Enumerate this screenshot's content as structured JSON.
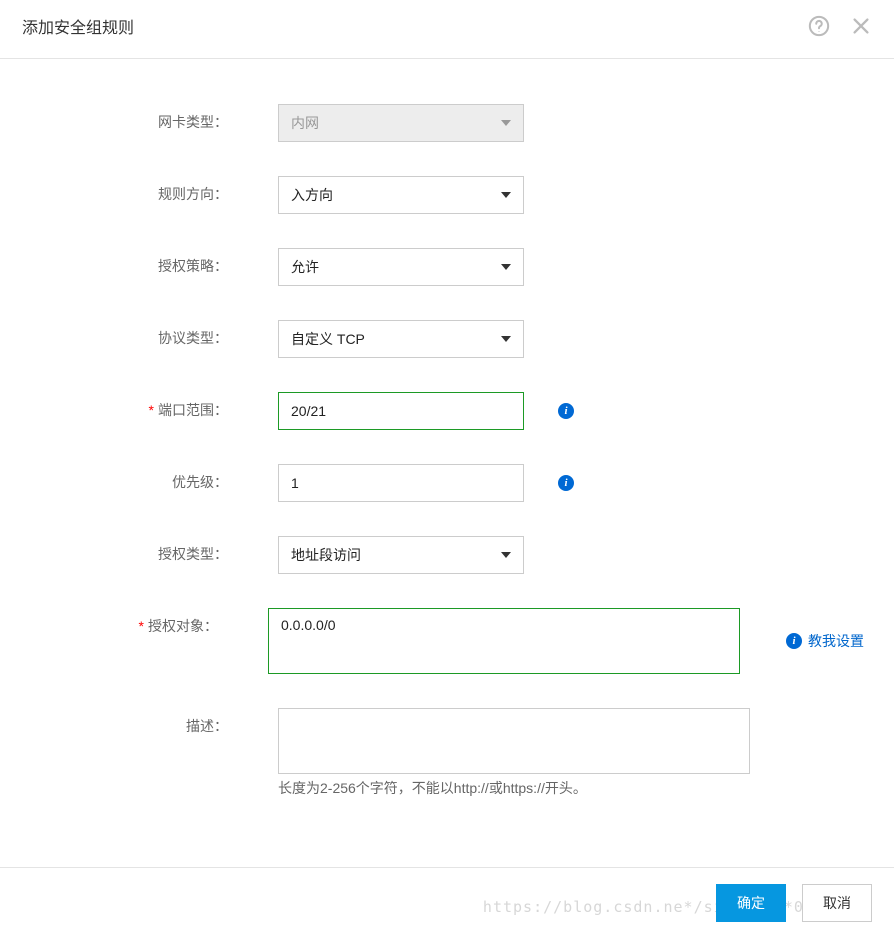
{
  "dialog": {
    "title": "添加安全组规则"
  },
  "form": {
    "nic_type": {
      "label": "网卡类型：",
      "value": "内网"
    },
    "rule_direction": {
      "label": "规则方向：",
      "value": "入方向"
    },
    "auth_policy": {
      "label": "授权策略：",
      "value": "允许"
    },
    "protocol_type": {
      "label": "协议类型：",
      "value": "自定义 TCP"
    },
    "port_range": {
      "label": "端口范围：",
      "value": "20/21"
    },
    "priority": {
      "label": "优先级：",
      "value": "1"
    },
    "auth_type": {
      "label": "授权类型：",
      "value": "地址段访问"
    },
    "auth_object": {
      "label": "授权对象：",
      "value": "0.0.0.0/0",
      "help_link": "教我设置"
    },
    "description": {
      "label": "描述：",
      "value": "",
      "hint": "长度为2-256个字符，不能以http://或https://开头。"
    }
  },
  "required_mark": "*",
  "footer": {
    "confirm": "确定",
    "cancel": "取消"
  },
  "watermark": "https://blog.csdn.ne*/sinat_***0325"
}
